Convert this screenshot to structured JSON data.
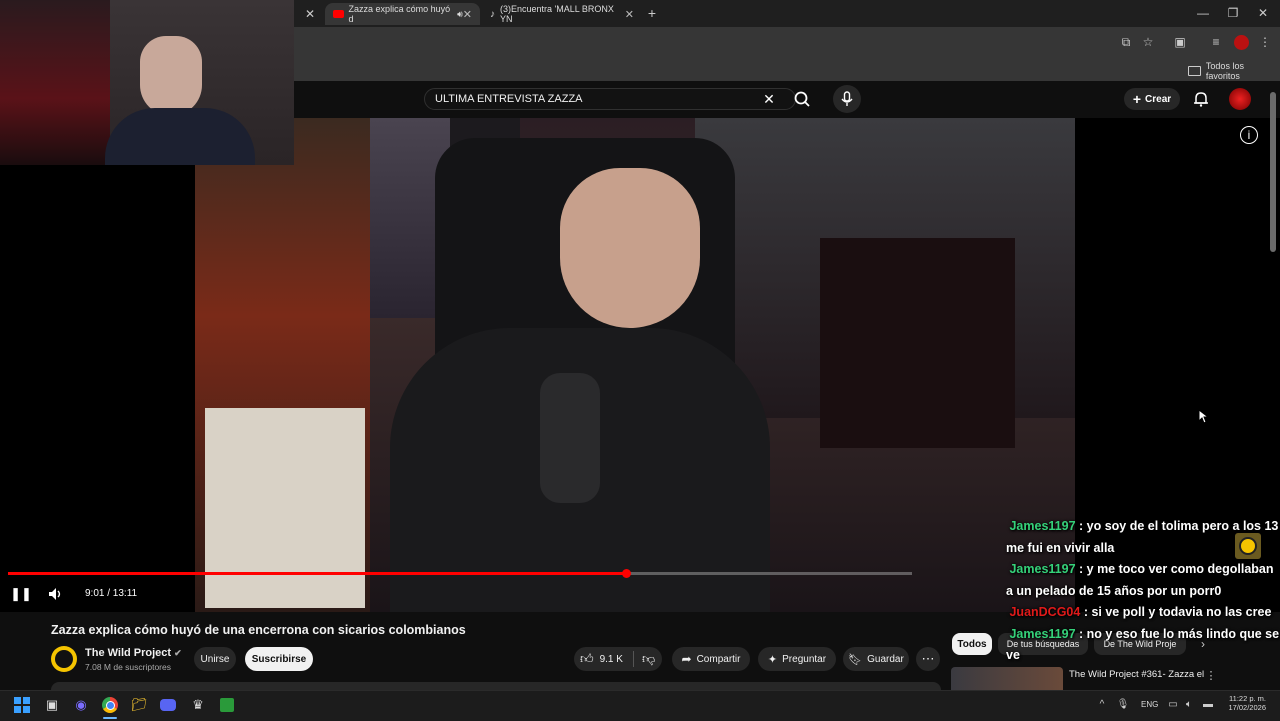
{
  "browser": {
    "tabs": [
      {
        "title": "Zazza explica cómo huyó d"
      },
      {
        "title": "(3)Encuentra 'MALL BRONX YN"
      }
    ],
    "new_tab_label": "+",
    "bookmarks_folder": "Todos los favoritos"
  },
  "youtube": {
    "search": {
      "value": "ULTIMA ENTREVISTA ZAZZA"
    },
    "create_label": "Crear"
  },
  "player": {
    "time": "9:01 / 13:11",
    "progress": 0.684
  },
  "video": {
    "title": "Zazza explica cómo huyó de una encerrona con sicarios colombianos",
    "channel": "The Wild Project",
    "subscribers": "7.08 M de suscriptores",
    "join_label": "Unirse",
    "subscribe_label": "Suscribirse",
    "likes": "9.1 K",
    "share_label": "Compartir",
    "ask_label": "Preguntar",
    "save_label": "Guardar"
  },
  "recommendations": {
    "chips": [
      "Todos",
      "De tus búsquedas",
      "De The Wild Proje"
    ],
    "first_title": "The Wild Project #361- Zazza el"
  },
  "chat": [
    {
      "user": "James1197",
      "text": "yo soy de el tolima pero a los 13 me fui en vivir alla"
    },
    {
      "user": "James1197",
      "text": "y me toco ver como degollaban a un pelado de 15 años por un porr0"
    },
    {
      "user": "JuanDCG04",
      "text": "si ve poll y todavia no las cree"
    },
    {
      "user": "James1197",
      "text": "no y eso fue lo más lindo que se ve"
    }
  ],
  "taskbar": {
    "lang": "ENG",
    "time": "11:22 p. m.",
    "date": "17/02/2026"
  }
}
